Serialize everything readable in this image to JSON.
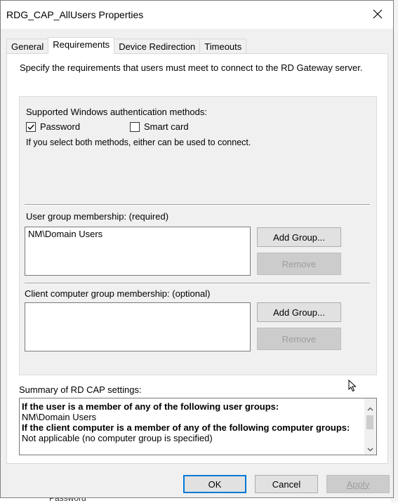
{
  "window": {
    "title": "RDG_CAP_AllUsers Properties",
    "close_glyph": "✕"
  },
  "tabs": [
    {
      "label": "General"
    },
    {
      "label": "Requirements"
    },
    {
      "label": "Device Redirection"
    },
    {
      "label": "Timeouts"
    }
  ],
  "requirements": {
    "intro": "Specify the requirements that users must meet to connect to the RD Gateway server.",
    "auth_label": "Supported Windows authentication methods:",
    "password_label": "Password",
    "password_checked": true,
    "smartcard_label": "Smart card",
    "smartcard_checked": false,
    "both_note": "If you select both methods, either can be used to connect.",
    "user_group_label": "User group membership: (required)",
    "user_groups": [
      "NM\\Domain Users"
    ],
    "client_group_label": "Client computer group membership: (optional)",
    "client_groups": [],
    "add_group_label": "Add Group...",
    "remove_label": "Remove"
  },
  "summary": {
    "label": "Summary of RD CAP settings:",
    "line1": "If the user is a member of any of the following user groups:",
    "line2": "NM\\Domain Users",
    "line3": "If the client computer is a member of any of the following computer groups:",
    "line4": "Not applicable (no computer group is specified)"
  },
  "footer": {
    "ok": "OK",
    "cancel": "Cancel",
    "apply": "Apply"
  },
  "backdrop": {
    "peek_text": "Password"
  },
  "colors": {
    "accent": "#0078d7",
    "dialog_bg": "#f0f0f0",
    "disabled_text": "#9d9d9d"
  }
}
